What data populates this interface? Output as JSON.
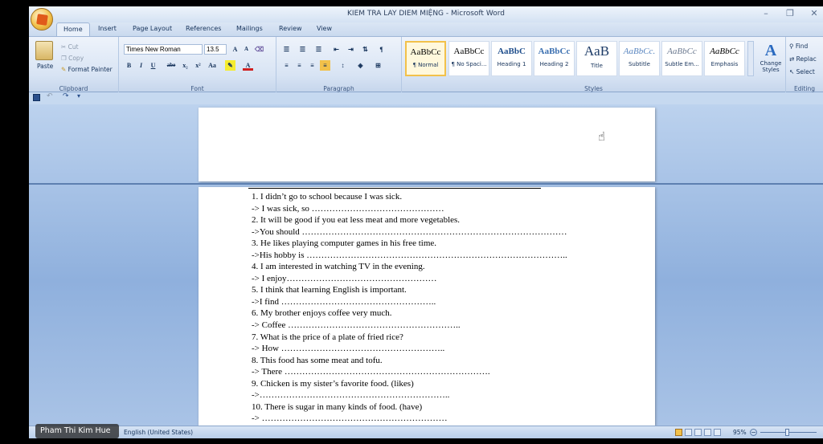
{
  "window": {
    "title": "KIEM TRA LAY DIEM MIỆNG - Microsoft Word",
    "minimize": "–",
    "restore": "❐",
    "close": "✕"
  },
  "tabs": [
    {
      "label": "Home",
      "active": true
    },
    {
      "label": "Insert"
    },
    {
      "label": "Page Layout"
    },
    {
      "label": "References"
    },
    {
      "label": "Mailings"
    },
    {
      "label": "Review"
    },
    {
      "label": "View"
    }
  ],
  "clipboard": {
    "label": "Clipboard",
    "paste": "Paste",
    "cut": "Cut",
    "copy": "Copy",
    "format_painter": "Format Painter"
  },
  "font": {
    "label": "Font",
    "name": "Times New Roman",
    "size": "13.5",
    "grow": "A",
    "shrink": "A",
    "bold": "B",
    "italic": "I",
    "underline": "U",
    "strike": "abe",
    "subscript": "x₂",
    "superscript": "x²",
    "change_case": "Aa",
    "font_color": "A"
  },
  "paragraph": {
    "label": "Paragraph"
  },
  "styles": {
    "label": "Styles",
    "items": [
      {
        "sample": "AaBbCc",
        "name": "¶ Normal",
        "selected": true
      },
      {
        "sample": "AaBbCc",
        "name": "¶ No Spaci..."
      },
      {
        "sample": "AaBbC",
        "name": "Heading 1"
      },
      {
        "sample": "AaBbCc",
        "name": "Heading 2"
      },
      {
        "sample": "AaB",
        "name": "Title"
      },
      {
        "sample": "AaBbCc.",
        "name": "Subtitle"
      },
      {
        "sample": "AaBbCc",
        "name": "Subtle Em..."
      },
      {
        "sample": "AaBbCc",
        "name": "Emphasis"
      }
    ],
    "change_styles": "Change Styles"
  },
  "editing": {
    "label": "Editing",
    "find": "Find",
    "replace": "Replac",
    "select": "Select"
  },
  "document": {
    "lines": [
      "1. I didn’t go to school because I was sick.",
      "-> I was sick, so ………………………………………",
      "2. It will be good if you eat less meat and more vegetables.",
      "->You should ………………………………………………………………………………",
      "3. He likes playing computer games in his free time.",
      "->His hobby is ……………………………………………………………………………..",
      "4. I am interested in watching TV in the evening.",
      "-> I enjoy……………………………………………",
      "5. I think that learning English is important.",
      "->I find ……………………………………………..",
      "6. My brother enjoys coffee very much.",
      "-> Coffee …………………………………………………..",
      "7. What is the price of a plate of fried rice?",
      "-> How ………………………………………………..",
      "8. This food has some meat and tofu.",
      "-> There …………………………………………………………….",
      "9. Chicken is my sister’s favorite food. (likes)",
      "->………………………………………………………..",
      "10. There is sugar in many kinds of food. (have)",
      "-> ………………………………………………………"
    ]
  },
  "status": {
    "language": "English (United States)",
    "zoom": "95%"
  },
  "watermark": "Pham Thi Kim Hue"
}
